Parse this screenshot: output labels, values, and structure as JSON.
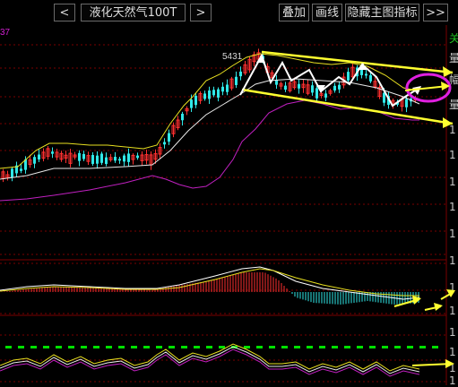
{
  "toolbar": {
    "prev_label": "<",
    "instrument_title": "液化天然气100T",
    "next_label": ">",
    "overlay_label": "叠加",
    "draw_label": "画线",
    "hide_indicator_label": "隐藏主图指标",
    "more_label": ">>"
  },
  "left_corner_value": "37",
  "price_high_label": "5431",
  "right_axis_glyphs": [
    "关",
    "量",
    "幅",
    "量",
    "1",
    "1",
    "1",
    "1",
    "1",
    "1",
    "1",
    "1",
    "1",
    "1",
    "1",
    "1"
  ],
  "colors": {
    "background": "#000000",
    "grid": "#7a0000",
    "candle_up": "#ff3030",
    "candle_down": "#30e8e8",
    "boll_upper": "#e8e020",
    "boll_mid": "#e8e8e8",
    "boll_lower": "#c020c0",
    "annotation_arrow": "#ffffff",
    "trend_channel": "#ffff30",
    "circle_mark": "#e020e0",
    "macd_dif": "#ffffff",
    "macd_dea": "#e8e020",
    "kdj_signal_dash": "#00e000"
  }
}
